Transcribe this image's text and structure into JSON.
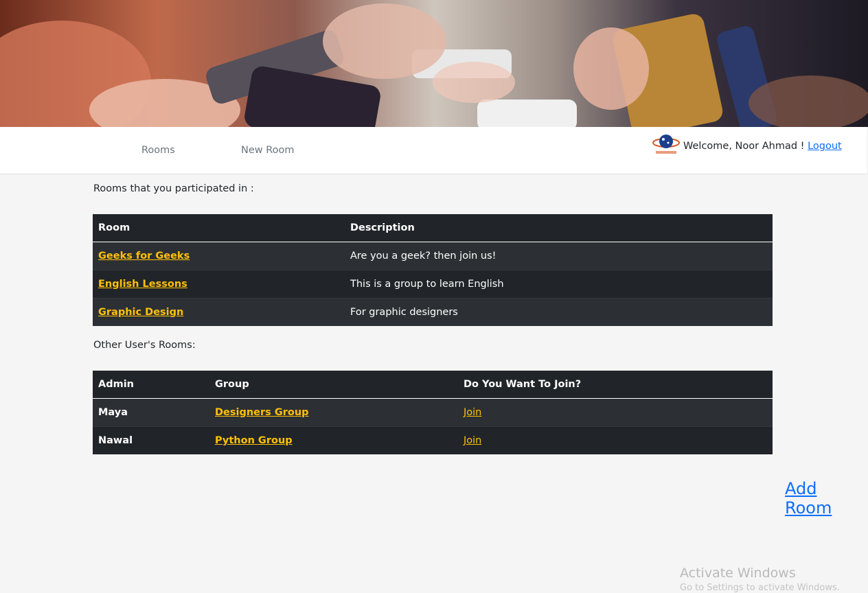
{
  "nav": {
    "rooms_label": "Rooms",
    "new_room_label": "New Room",
    "welcome_text": "Welcome, Noor Ahmad ! ",
    "logout_label": "Logout"
  },
  "participated": {
    "heading": "Rooms that you participated in :",
    "columns": [
      "Room",
      "Description"
    ],
    "rows": [
      {
        "room": "Geeks for Geeks",
        "description": "Are you a geek? then join us!"
      },
      {
        "room": "English Lessons",
        "description": "This is a group to learn English"
      },
      {
        "room": "Graphic Design",
        "description": "For graphic designers"
      }
    ]
  },
  "others": {
    "heading": "Other User's Rooms:",
    "columns": [
      "Admin",
      "Group",
      "Do You Want To Join?"
    ],
    "rows": [
      {
        "admin": "Maya",
        "group": "Designers Group",
        "action": "Join"
      },
      {
        "admin": "Nawal",
        "group": "Python Group",
        "action": "Join"
      }
    ]
  },
  "add_room_label": "Add Room",
  "watermark": {
    "title": "Activate Windows",
    "subtitle": "Go to Settings to activate Windows."
  },
  "colors": {
    "link_accent": "#ffc107",
    "primary_link": "#0d6efd",
    "table_dark": "#212529"
  },
  "icons": {
    "logo": "world-web-logo-icon"
  }
}
